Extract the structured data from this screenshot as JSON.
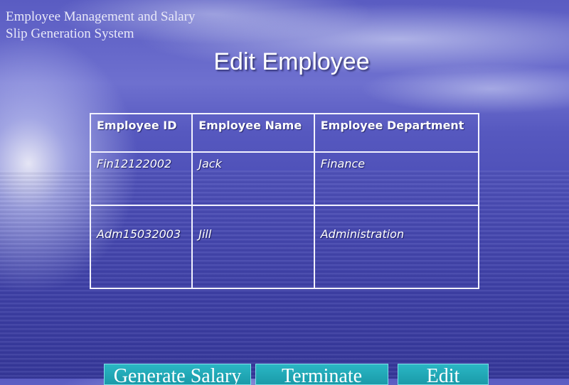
{
  "app_title": "Employee  Management and Salary\nSlip Generation System",
  "page_title": "Edit Employee",
  "table": {
    "headers": [
      "Employee ID",
      "Employee Name",
      "Employee Department"
    ],
    "rows": [
      [
        "Fin12122002",
        "Jack",
        "Finance"
      ],
      [
        "Adm15032003",
        "Jill",
        "Administration"
      ]
    ]
  },
  "buttons": {
    "generate_salary": "Generate Salary",
    "terminate": "Terminate",
    "edit": "Edit"
  },
  "colors": {
    "background": "#5658bf",
    "button": "#1fa8b6",
    "table_border": "#f2f2ff"
  }
}
